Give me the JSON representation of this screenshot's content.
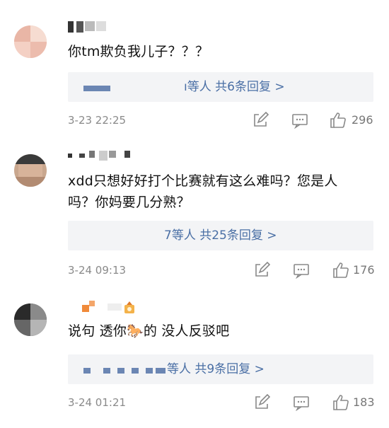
{
  "comments": [
    {
      "text_line1": "你tm欺负我儿子？？？",
      "text_line2": "",
      "reply_label": "ı等人  共6条回复 >",
      "time": "3-23 22:25",
      "likes": "296"
    },
    {
      "text_line1": "xdd只想好好打个比赛就有这么难吗？您是人",
      "text_line2": "吗？你妈要几分熟？",
      "reply_label": "7等人  共25条回复 >",
      "time": "3-24 09:13",
      "likes": "176"
    },
    {
      "text_line1": "说句 透你🐎的 没人反驳吧",
      "text_line2": "",
      "reply_label": "等人  共9条回复 >",
      "time": "3-24 01:21",
      "likes": "183"
    }
  ],
  "icons": [
    "edit-icon",
    "comment-icon",
    "thumbs-up-icon"
  ],
  "colors": {
    "link": "#4a6fa5",
    "reply_bg": "#f3f4f6",
    "meta": "#8a8a8a"
  }
}
